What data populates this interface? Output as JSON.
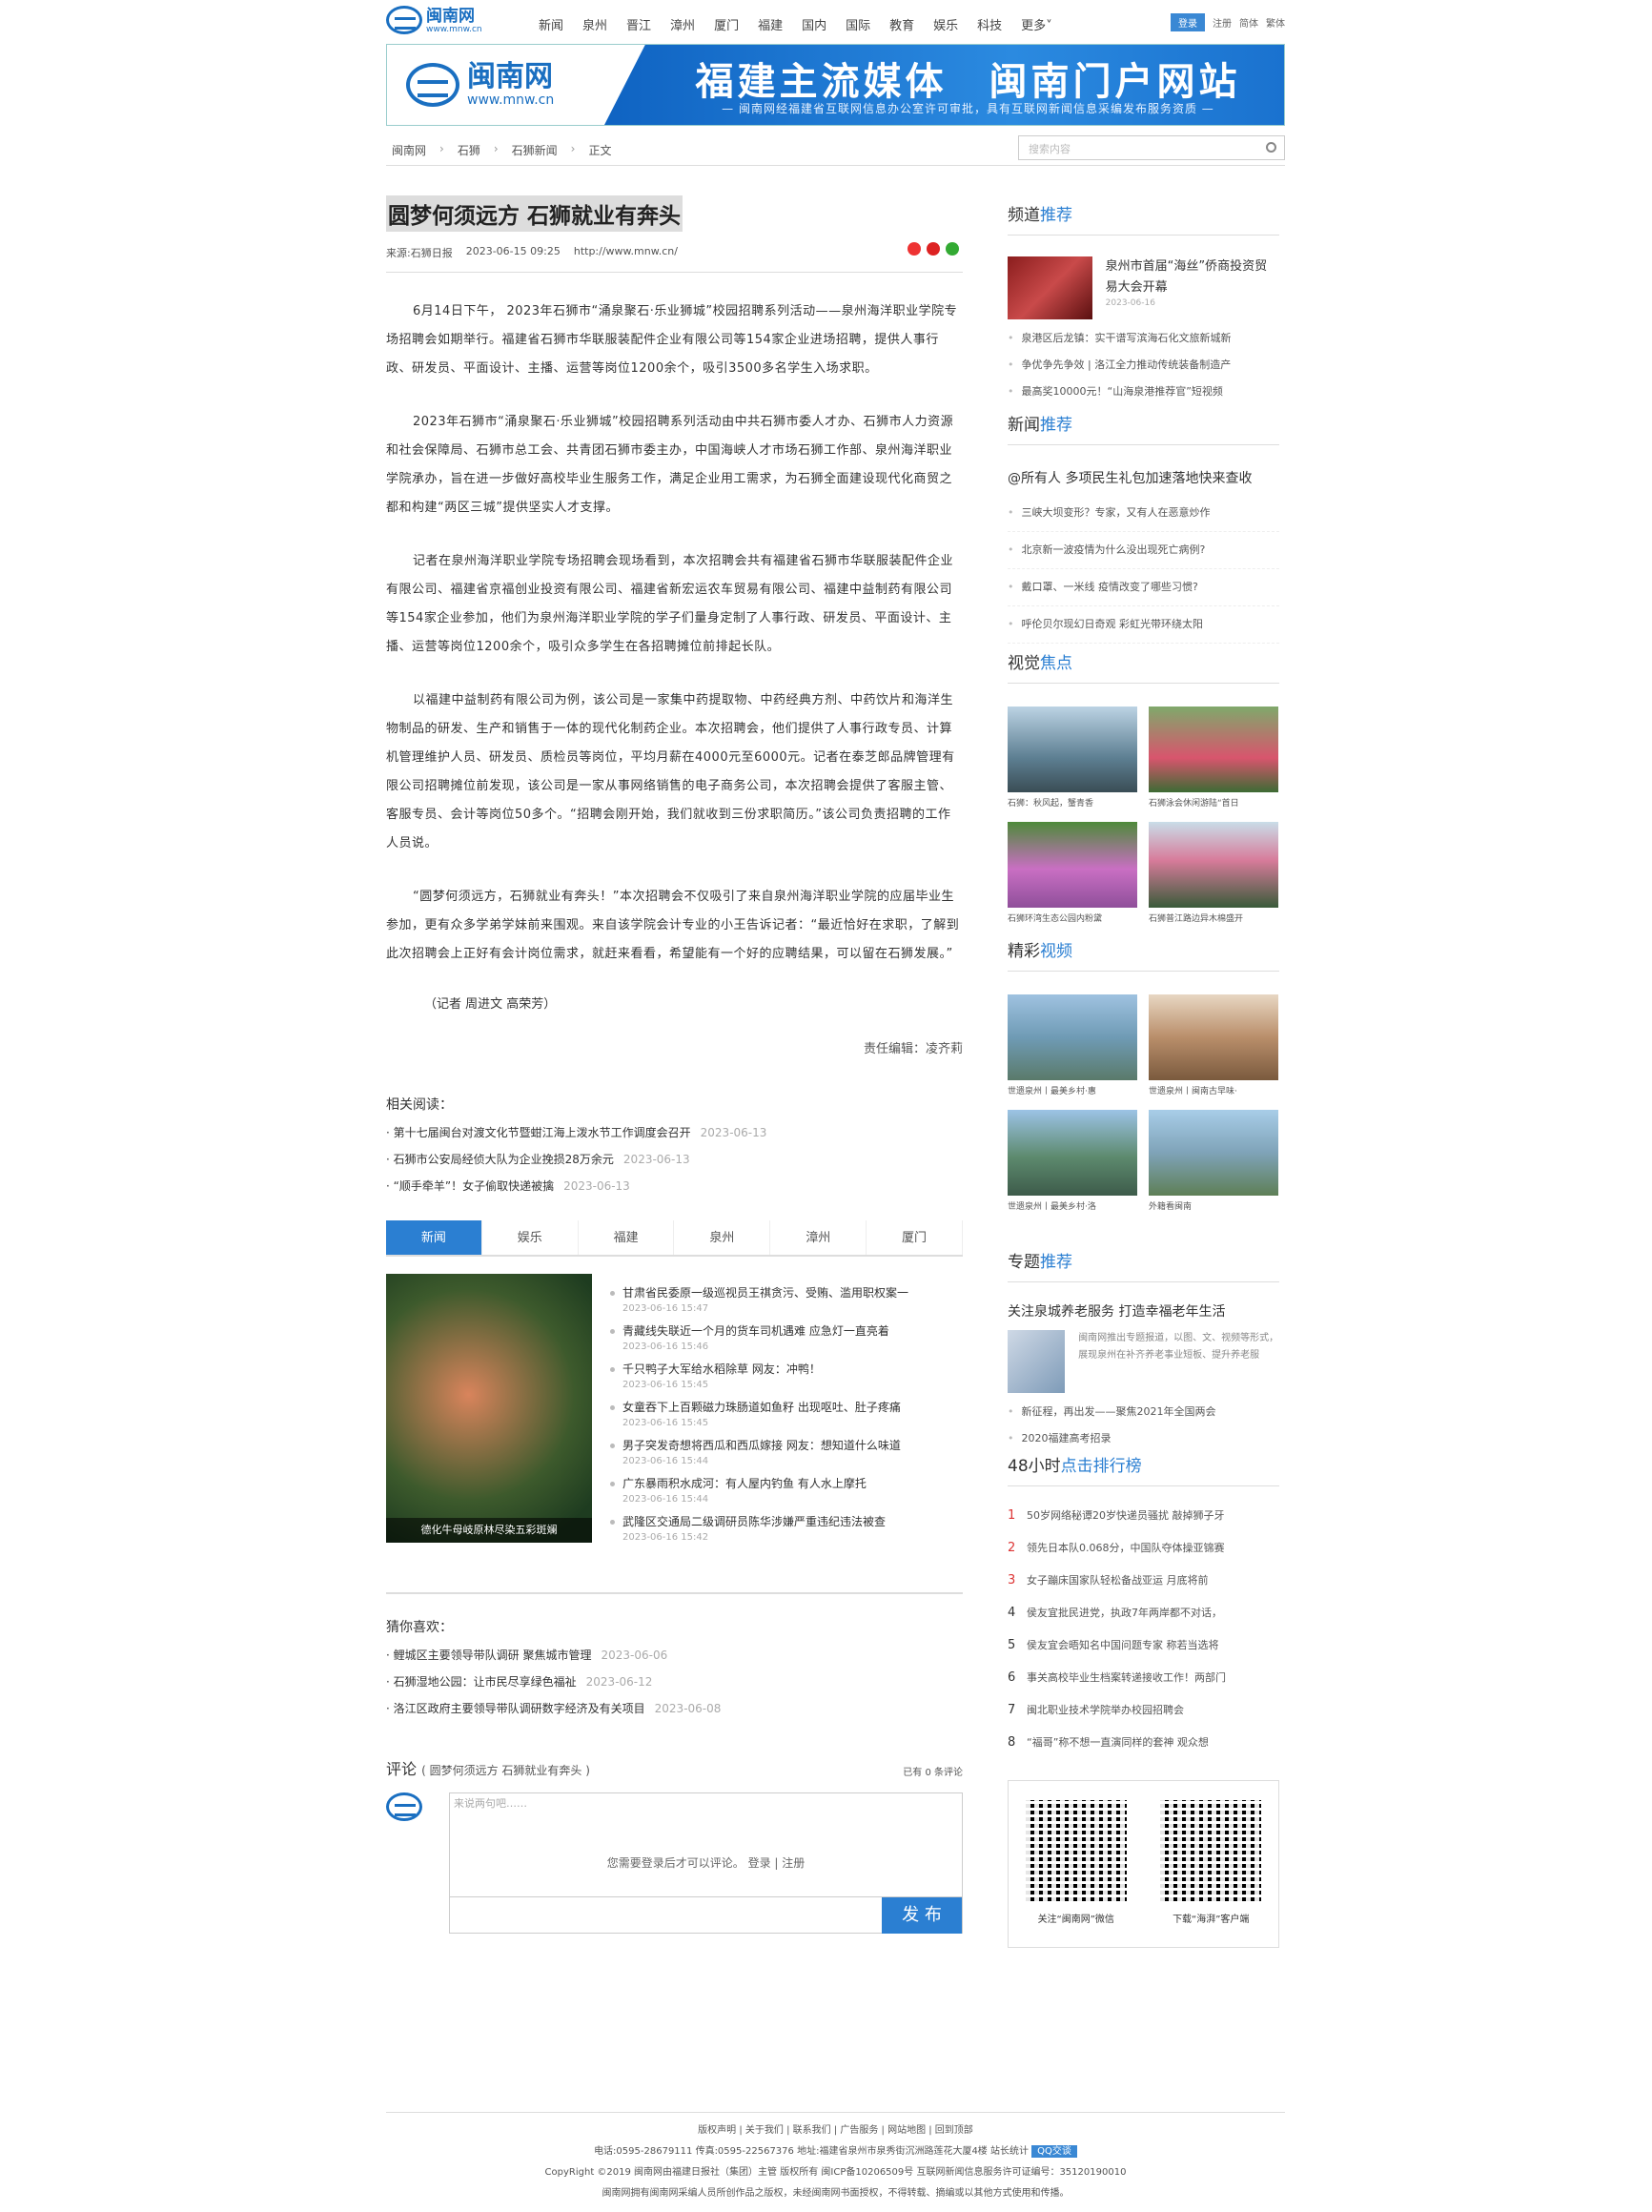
{
  "topnav": {
    "logo": "闽南网",
    "logo_url": "www.mnw.cn",
    "links": [
      "新闻",
      "泉州",
      "晋江",
      "漳州",
      "厦门",
      "福建",
      "国内",
      "国际",
      "教育",
      "娱乐",
      "科技",
      "更多"
    ],
    "login": "登录",
    "register": "注册",
    "simplified": "简体",
    "traditional": "繁体"
  },
  "banner": {
    "name": "闽南网",
    "url": "www.mnw.cn",
    "slogan": "福建主流媒体　闽南门户网站",
    "sub": "— 闽南网经福建省互联网信息办公室许可审批，具有互联网新闻信息采编发布服务资质 —"
  },
  "breadcrumb": [
    "闽南网",
    "石狮",
    "石狮新闻",
    "正文"
  ],
  "search": {
    "placeholder": "搜索内容"
  },
  "article": {
    "title": "圆梦何须远方 石狮就业有奔头",
    "source": "来源:石狮日报",
    "date": "2023-06-15 09:25",
    "url": "http://www.mnw.cn/",
    "paragraphs": [
      "6月14日下午， 2023年石狮市“涌泉聚石·乐业狮城”校园招聘系列活动——泉州海洋职业学院专场招聘会如期举行。福建省石狮市华联服装配件企业有限公司等154家企业进场招聘，提供人事行政、研发员、平面设计、主播、运营等岗位1200余个，吸引3500多名学生入场求职。",
      "2023年石狮市“涌泉聚石·乐业狮城”校园招聘系列活动由中共石狮市委人才办、石狮市人力资源和社会保障局、石狮市总工会、共青团石狮市委主办，中国海峡人才市场石狮工作部、泉州海洋职业学院承办，旨在进一步做好高校毕业生服务工作，满足企业用工需求，为石狮全面建设现代化商贸之都和构建“两区三城”提供坚实人才支撑。",
      "记者在泉州海洋职业学院专场招聘会现场看到，本次招聘会共有福建省石狮市华联服装配件企业有限公司、福建省京福创业投资有限公司、福建省新宏运农车贸易有限公司、福建中益制药有限公司等154家企业参加，他们为泉州海洋职业学院的学子们量身定制了人事行政、研发员、平面设计、主播、运营等岗位1200余个，吸引众多学生在各招聘摊位前排起长队。",
      "以福建中益制药有限公司为例，该公司是一家集中药提取物、中药经典方剂、中药饮片和海洋生物制品的研发、生产和销售于一体的现代化制药企业。本次招聘会，他们提供了人事行政专员、计算机管理维护人员、研发员、质检员等岗位，平均月薪在4000元至6000元。记者在泰芝郎品牌管理有限公司招聘摊位前发现，该公司是一家从事网络销售的电子商务公司，本次招聘会提供了客服主管、客服专员、会计等岗位50多个。“招聘会刚开始，我们就收到三份求职简历。”该公司负责招聘的工作人员说。",
      "“圆梦何须远方，石狮就业有奔头！”本次招聘会不仅吸引了来自泉州海洋职业学院的应届毕业生参加，更有众多学弟学妹前来围观。来自该学院会计专业的小王告诉记者：“最近恰好在求职，了解到此次招聘会上正好有会计岗位需求，就赶来看看，希望能有一个好的应聘结果，可以留在石狮发展。”"
    ],
    "author": "（记者 周进文 高荣芳）",
    "editor": "责任编辑：凌齐莉"
  },
  "related": {
    "label": "相关阅读：",
    "items": [
      {
        "t": "第十七届闽台对渡文化节暨蚶江海上泼水节工作调度会召开",
        "d": "2023-06-13"
      },
      {
        "t": "石狮市公安局经侦大队为企业挽损28万余元",
        "d": "2023-06-13"
      },
      {
        "t": "“顺手牵羊”！女子偷取快递被擒",
        "d": "2023-06-13"
      }
    ]
  },
  "tabs": [
    "新闻",
    "娱乐",
    "福建",
    "泉州",
    "漳州",
    "厦门"
  ],
  "newsblock": {
    "caption": "德化牛母岐原林尽染五彩斑斓",
    "items": [
      {
        "t": "甘肃省民委原一级巡视员王祺贪污、受贿、滥用职权案一",
        "d": "2023-06-16 15:47"
      },
      {
        "t": "青藏线失联近一个月的货车司机遇难 应急灯一直亮着",
        "d": "2023-06-16 15:46"
      },
      {
        "t": "千只鸭子大军给水稻除草 网友：冲鸭！",
        "d": "2023-06-16 15:45"
      },
      {
        "t": "女童吞下上百颗磁力珠肠道如鱼籽 出现呕吐、肚子疼痛",
        "d": "2023-06-16 15:45"
      },
      {
        "t": "男子突发奇想将西瓜和西瓜嫁接 网友：想知道什么味道",
        "d": "2023-06-16 15:44"
      },
      {
        "t": "广东暴雨积水成河：有人屋内钓鱼 有人水上摩托",
        "d": "2023-06-16 15:44"
      },
      {
        "t": "武隆区交通局二级调研员陈华涉嫌严重违纪违法被查",
        "d": "2023-06-16 15:42"
      }
    ]
  },
  "guess": {
    "label": "猜你喜欢：",
    "items": [
      {
        "t": "鲤城区主要领导带队调研 聚焦城市管理",
        "d": "2023-06-06"
      },
      {
        "t": "石狮湿地公园：让市民尽享绿色福祉",
        "d": "2023-06-12"
      },
      {
        "t": "洛江区政府主要领导带队调研数字经济及有关项目",
        "d": "2023-06-08"
      }
    ]
  },
  "comment": {
    "title": "评论",
    "sub": "( 圆梦何须远方 石狮就业有奔头 )",
    "count": "已有 0 条评论",
    "placeholder": "来说两句吧……",
    "notice": "您需要登录后才可以评论。 登录 | 注册",
    "submit": "发 布"
  },
  "sidebar": {
    "channel": {
      "title_a": "频道",
      "title_b": "推荐",
      "feat_title": "泉州市首届“海丝”侨商投资贸易大会开幕",
      "feat_date": "2023-06-16",
      "items": [
        "泉港区后龙镇：实干谱写滨海石化文旅新城新",
        "争优争先争效 | 洛江全力推动传统装备制造产",
        "最高奖10000元！“山海泉港推荐官”短视频"
      ]
    },
    "news": {
      "title_a": "新闻",
      "title_b": "推荐",
      "head": "@所有人 多项民生礼包加速落地快来查收",
      "items": [
        "三峡大坝变形？专家，又有人在恶意炒作",
        "北京新一波疫情为什么没出现死亡病例?",
        "戴口罩、一米线 疫情改变了哪些习惯?",
        "呼伦贝尔现幻日奇观 彩虹光带环绕太阳"
      ]
    },
    "visual": {
      "title_a": "视觉",
      "title_b": "焦点",
      "items": [
        "石狮：秋风起，蟹青香",
        "石狮泳会休闲游陆“首日",
        "石狮环湾生态公园内粉黛",
        "石狮普江路边异木棉盛开"
      ]
    },
    "video": {
      "title_a": "精彩",
      "title_b": "视频",
      "items": [
        "世遗泉州丨最美乡村·惠",
        "世遗泉州丨闽南古早味·",
        "世遗泉州丨最美乡村·洛",
        "外籍看闽南"
      ]
    },
    "topic": {
      "title_a": "专题",
      "title_b": "推荐",
      "head": "关注泉城养老服务 打造幸福老年生活",
      "desc": "闽南网推出专题报道，以图、文、视频等形式，展现泉州在补齐养老事业短板、提升养老服",
      "items": [
        "新征程，再出发——聚焦2021年全国两会",
        "2020福建高考招录"
      ]
    },
    "rank": {
      "title_a": "48小时",
      "title_b": "点击排行榜",
      "items": [
        "50岁网络秘谭20岁快递员骚扰 敲掉狮子牙",
        "领先日本队0.068分，中国队夺体操亚锦赛",
        "女子蹦床国家队轻松备战亚运 月底将前",
        "侯友宜批民进党，执政7年两岸都不对话，",
        "侯友宜会晤知名中国问题专家 称若当选将",
        "事关高校毕业生档案转递接收工作！两部门",
        "闽北职业技术学院举办校园招聘会",
        "“福哥”称不想一直演同样的套神 观众想"
      ]
    },
    "qr": [
      "关注“闽南网”微信",
      "下载“海湃”客户端"
    ]
  },
  "footer": {
    "links": "版权声明 | 关于我们 | 联系我们 | 广告服务 | 网站地图 | 回到顶部",
    "contact": "电话:0595-28679111 传真:0595-22567376 地址:福建省泉州市泉秀街沉洲路莲花大厦4楼 站长统计",
    "qq": "QQ交谈",
    "copyright": "CopyRight ©2019 闽南网由福建日报社（集团）主管 版权所有 闽ICP备10206509号 互联网新闻信息服务许可证编号：35120190010",
    "notice": "闽南网拥有闽南网采编人员所创作品之版权，未经闽南网书面授权，不得转载、摘编或以其他方式使用和传播。"
  }
}
